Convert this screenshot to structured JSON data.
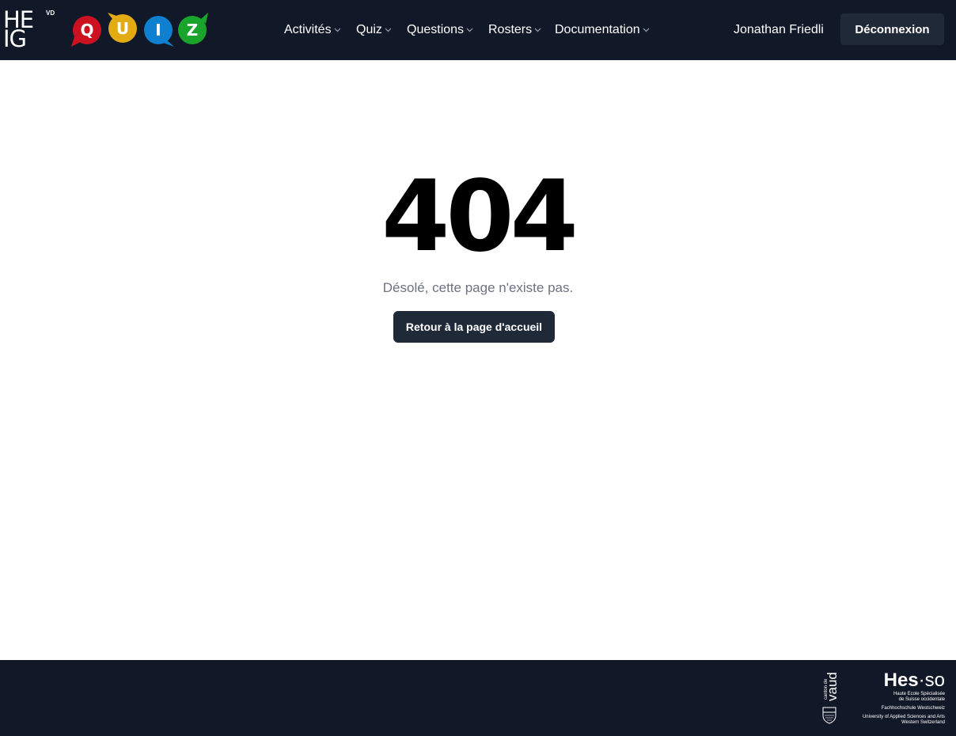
{
  "header": {
    "brand": {
      "heig_line1": "HE",
      "heig_line2": "IG",
      "heig_sub": "VD",
      "quiz_letters": [
        "Q",
        "U",
        "I",
        "Z"
      ],
      "quiz_colors": [
        "#cc1120",
        "#e3ab12",
        "#0f7fcf",
        "#19a52b"
      ]
    },
    "nav": [
      {
        "label": "Activités"
      },
      {
        "label": "Quiz"
      },
      {
        "label": "Questions"
      },
      {
        "label": "Rosters"
      },
      {
        "label": "Documentation"
      }
    ],
    "user_name": "Jonathan Friedli",
    "logout_label": "Déconnexion"
  },
  "main": {
    "error_code": "404",
    "message": "Désolé, cette page n'existe pas.",
    "home_button_label": "Retour à la page d'accueil"
  },
  "footer": {
    "vaud_small": "canton de",
    "vaud_big": "vaud",
    "hesso_main": "Hes",
    "hesso_dot": "·",
    "hesso_so": "so",
    "hesso_lines": [
      "Haute Ecole Spécialisée",
      "de Suisse occidentale",
      "Fachhochschule Westschweiz",
      "University of Applied Sciences and Arts",
      "Western Switzerland"
    ]
  },
  "colors": {
    "header_bg": "#111827",
    "button_bg": "#1f2937",
    "message_text": "#6b7280"
  }
}
